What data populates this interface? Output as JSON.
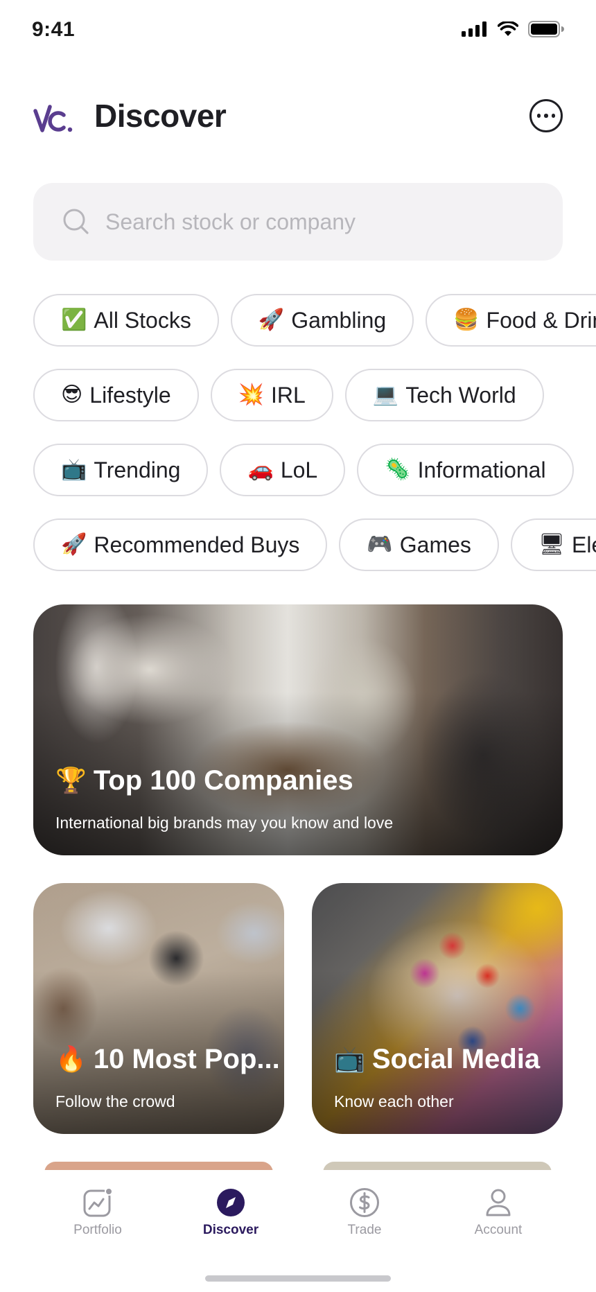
{
  "status_bar": {
    "time": "9:41"
  },
  "header": {
    "title": "Discover"
  },
  "search": {
    "placeholder": "Search stock or company"
  },
  "chip_rows": [
    [
      {
        "emoji": "✅",
        "label": "All Stocks"
      },
      {
        "emoji": "🚀",
        "label": "Gambling"
      },
      {
        "emoji": "🍔",
        "label": "Food & Drin"
      }
    ],
    [
      {
        "emoji": "😎",
        "label": "Lifestyle"
      },
      {
        "emoji": "💥",
        "label": "IRL"
      },
      {
        "emoji": "💻",
        "label": "Tech World"
      }
    ],
    [
      {
        "emoji": "📺",
        "label": "Trending"
      },
      {
        "emoji": "🚗",
        "label": "LoL"
      },
      {
        "emoji": "🦠",
        "label": "Informational"
      }
    ],
    [
      {
        "emoji": "🚀",
        "label": "Recommended Buys"
      },
      {
        "emoji": "🎮",
        "label": "Games"
      },
      {
        "emoji": "🖥",
        "label": "Elec"
      }
    ]
  ],
  "cards": {
    "top100": {
      "emoji": "🏆",
      "title": "Top 100 Companies",
      "subtitle": "International big brands may you know and love"
    },
    "popular": {
      "emoji": "🔥",
      "title": "10 Most Pop...",
      "subtitle": "Follow the crowd"
    },
    "social": {
      "emoji": "📺",
      "title": "Social Media",
      "subtitle": "Know each other"
    }
  },
  "tab_bar": {
    "portfolio": "Portfolio",
    "discover": "Discover",
    "trade": "Trade",
    "account": "Account"
  },
  "colors": {
    "brand": "#5a3d8f",
    "active_tab": "#2b1a5e",
    "inactive_tab": "#9b9aa1",
    "chip_border": "#dcdbe0",
    "search_bg": "#f3f2f4"
  }
}
